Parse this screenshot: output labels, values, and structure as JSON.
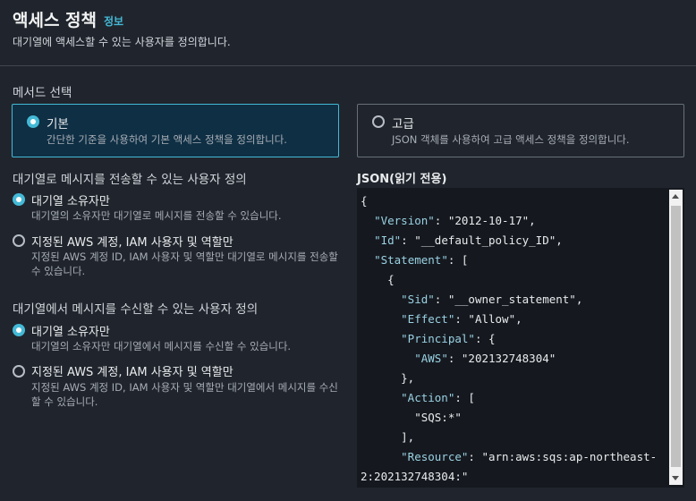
{
  "header": {
    "title": "액세스 정책",
    "info_link": "정보",
    "description": "대기열에 액세스할 수 있는 사용자를 정의합니다."
  },
  "method": {
    "label": "메서드 선택",
    "options": [
      {
        "title": "기본",
        "description": "간단한 기준을 사용하여 기본 액세스 정책을 정의합니다.",
        "selected": true
      },
      {
        "title": "고급",
        "description": "JSON 객체를 사용하여 고급 액세스 정책을 정의합니다.",
        "selected": false
      }
    ]
  },
  "send_section": {
    "title": "대기열로 메시지를 전송할 수 있는 사용자 정의",
    "options": [
      {
        "title": "대기열 소유자만",
        "description": "대기열의 소유자만 대기열로 메시지를 전송할 수 있습니다.",
        "selected": true
      },
      {
        "title": "지정된 AWS 계정, IAM 사용자 및 역할만",
        "description": "지정된 AWS 계정 ID, IAM 사용자 및 역할만 대기열로 메시지를 전송할 수 있습니다.",
        "selected": false
      }
    ]
  },
  "receive_section": {
    "title": "대기열에서 메시지를 수신할 수 있는 사용자 정의",
    "options": [
      {
        "title": "대기열 소유자만",
        "description": "대기열의 소유자만 대기열에서 메시지를 수신할 수 있습니다.",
        "selected": true
      },
      {
        "title": "지정된 AWS 계정, IAM 사용자 및 역할만",
        "description": "지정된 AWS 계정 ID, IAM 사용자 및 역할만 대기열에서 메시지를 수신할 수 있습니다.",
        "selected": false
      }
    ]
  },
  "json_panel": {
    "label": "JSON(읽기 전용)",
    "lines": [
      "{",
      "  \"Version\": \"2012-10-17\",",
      "  \"Id\": \"__default_policy_ID\",",
      "  \"Statement\": [",
      "    {",
      "      \"Sid\": \"__owner_statement\",",
      "      \"Effect\": \"Allow\",",
      "      \"Principal\": {",
      "        \"AWS\": \"202132748304\"",
      "      },",
      "      \"Action\": [",
      "        \"SQS:*\"",
      "      ],",
      "      \"Resource\": \"arn:aws:sqs:ap-northeast-",
      "2:202132748304:\""
    ]
  },
  "colors": {
    "background": "#20252d",
    "accent": "#44b9d6",
    "selected_tile_bg": "#0f2f44",
    "json_bg": "#15191f"
  }
}
